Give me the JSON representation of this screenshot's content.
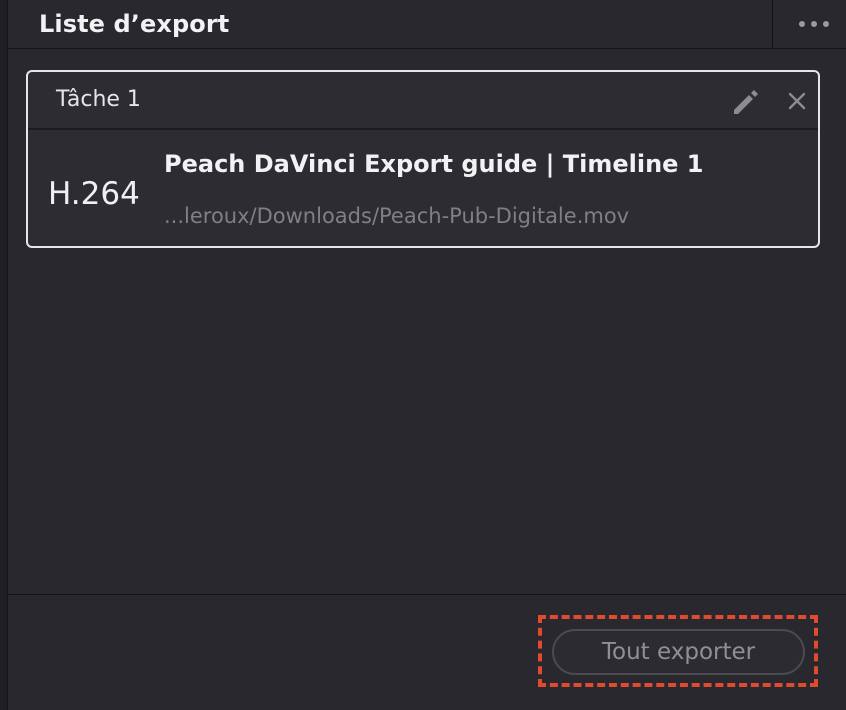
{
  "header": {
    "title": "Liste d’export",
    "more_icon": "more-horizontal-icon"
  },
  "job": {
    "name": "Tâche 1",
    "edit_icon": "pencil-icon",
    "close_icon": "close-icon",
    "codec": "H.264",
    "title": "Peach DaVinci Export guide | Timeline 1",
    "path": "...leroux/Downloads/Peach-Pub-Digitale.mov"
  },
  "footer": {
    "export_all_label": "Tout exporter",
    "highlight_color": "#e04a2f"
  },
  "colors": {
    "background": "#28282e",
    "card_border": "#e6e6ea",
    "muted_text": "#7f7f86"
  }
}
